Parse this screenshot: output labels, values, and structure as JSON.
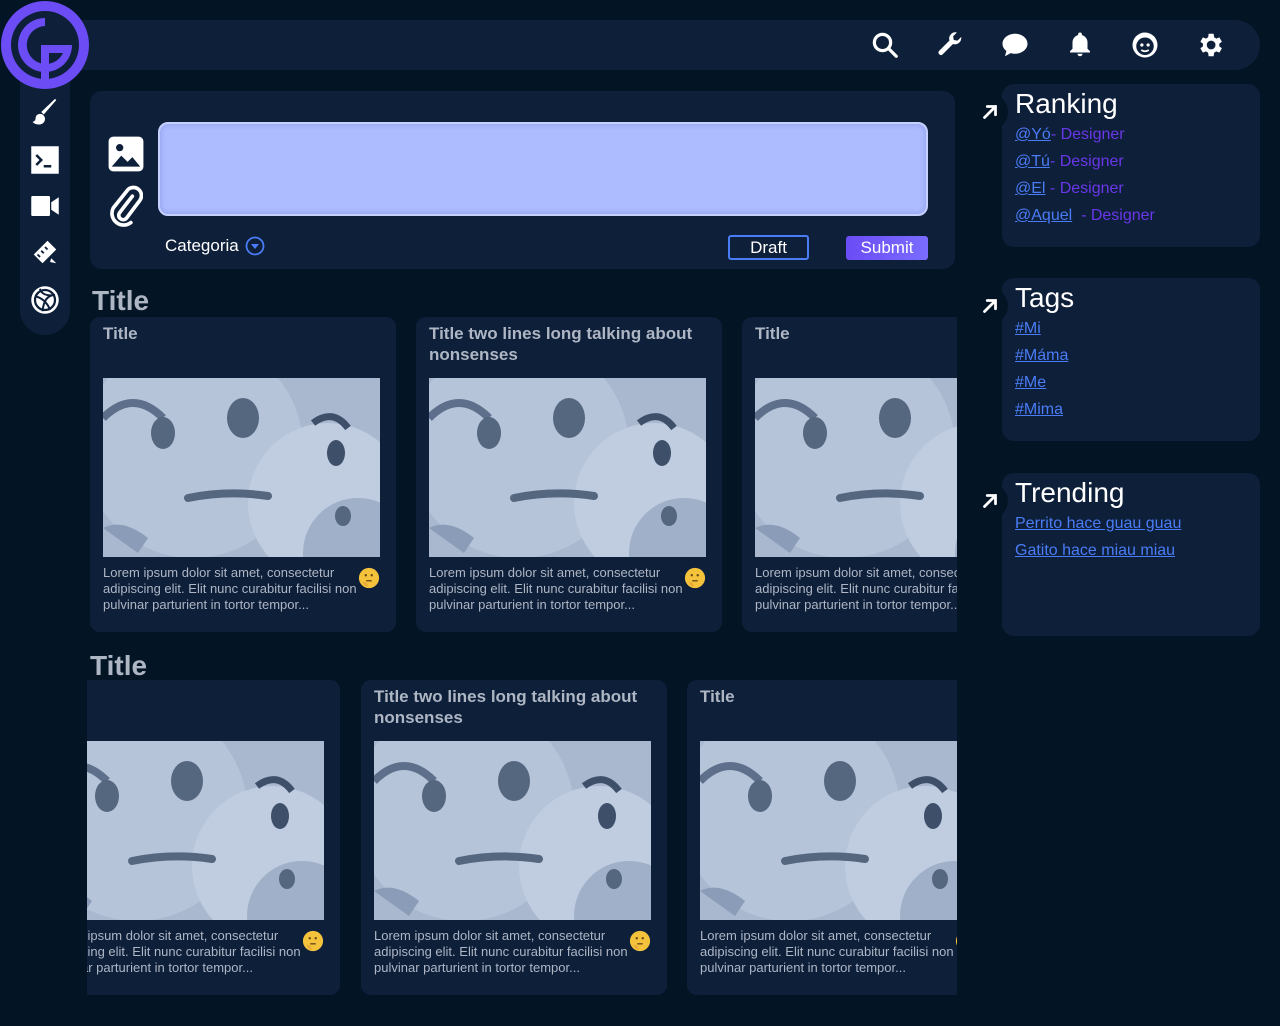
{
  "composer": {
    "category_label": "Categoria",
    "draft_label": "Draft",
    "submit_label": "Submit"
  },
  "sections": [
    {
      "title": "Title",
      "cards": [
        {
          "title": "Title",
          "body": "Lorem ipsum dolor sit amet, consectetur adipiscing elit. Elit nunc curabitur facilisi non pulvinar parturient in tortor tempor..."
        },
        {
          "title": "Title two lines long talking about nonsenses",
          "body": "Lorem ipsum dolor sit amet, consectetur adipiscing elit. Elit nunc curabitur facilisi non pulvinar parturient in tortor tempor..."
        },
        {
          "title": "Title",
          "body": "Lorem ipsum dolor sit amet, consectetur adipiscing elit. Elit nunc curabitur facilisi non pulvinar parturient in tortor tempor..."
        }
      ]
    },
    {
      "title": "Title",
      "cards": [
        {
          "title": "",
          "body": "Lorem ipsum dolor sit amet, consectetur adipiscing elit. Elit nunc curabitur facilisi non pulvinar parturient in tortor tempor..."
        },
        {
          "title": "Title two lines long talking about nonsenses",
          "body": "Lorem ipsum dolor sit amet, consectetur adipiscing elit. Elit nunc curabitur facilisi non pulvinar parturient in tortor tempor..."
        },
        {
          "title": "Title",
          "body": "Lorem ipsum dolor sit amet, consectetur adipiscing elit. Elit nunc curabitur facilisi non pulvinar parturient in tortor tempor..."
        }
      ]
    }
  ],
  "ranking": {
    "title": "Ranking",
    "items": [
      {
        "user": "@Yó",
        "role": "- Designer"
      },
      {
        "user": "@Tú",
        "role": "- Designer"
      },
      {
        "user": "@El",
        "role": " - Designer"
      },
      {
        "user": "@Aquel",
        "role": "  - Designer"
      }
    ]
  },
  "tags": {
    "title": "Tags",
    "items": [
      "#Mi",
      "#Máma",
      "#Me",
      "#Mima"
    ]
  },
  "trending": {
    "title": "Trending",
    "items": [
      "Perrito hace guau guau",
      "Gatito hace miau miau"
    ]
  },
  "icons": {
    "top": [
      "search-icon",
      "wrench-icon",
      "chat-icon",
      "bell-icon",
      "avatar-icon",
      "settings-icon"
    ],
    "rail": [
      "brush-icon",
      "terminal-icon",
      "video-icon",
      "ruler-pencil-icon",
      "ball-icon"
    ]
  },
  "colors": {
    "background": "#031525",
    "panel": "#0e1f3a",
    "accent": "#6b4cf5",
    "link": "#4a7cf5",
    "textarea": "#adbcff"
  }
}
